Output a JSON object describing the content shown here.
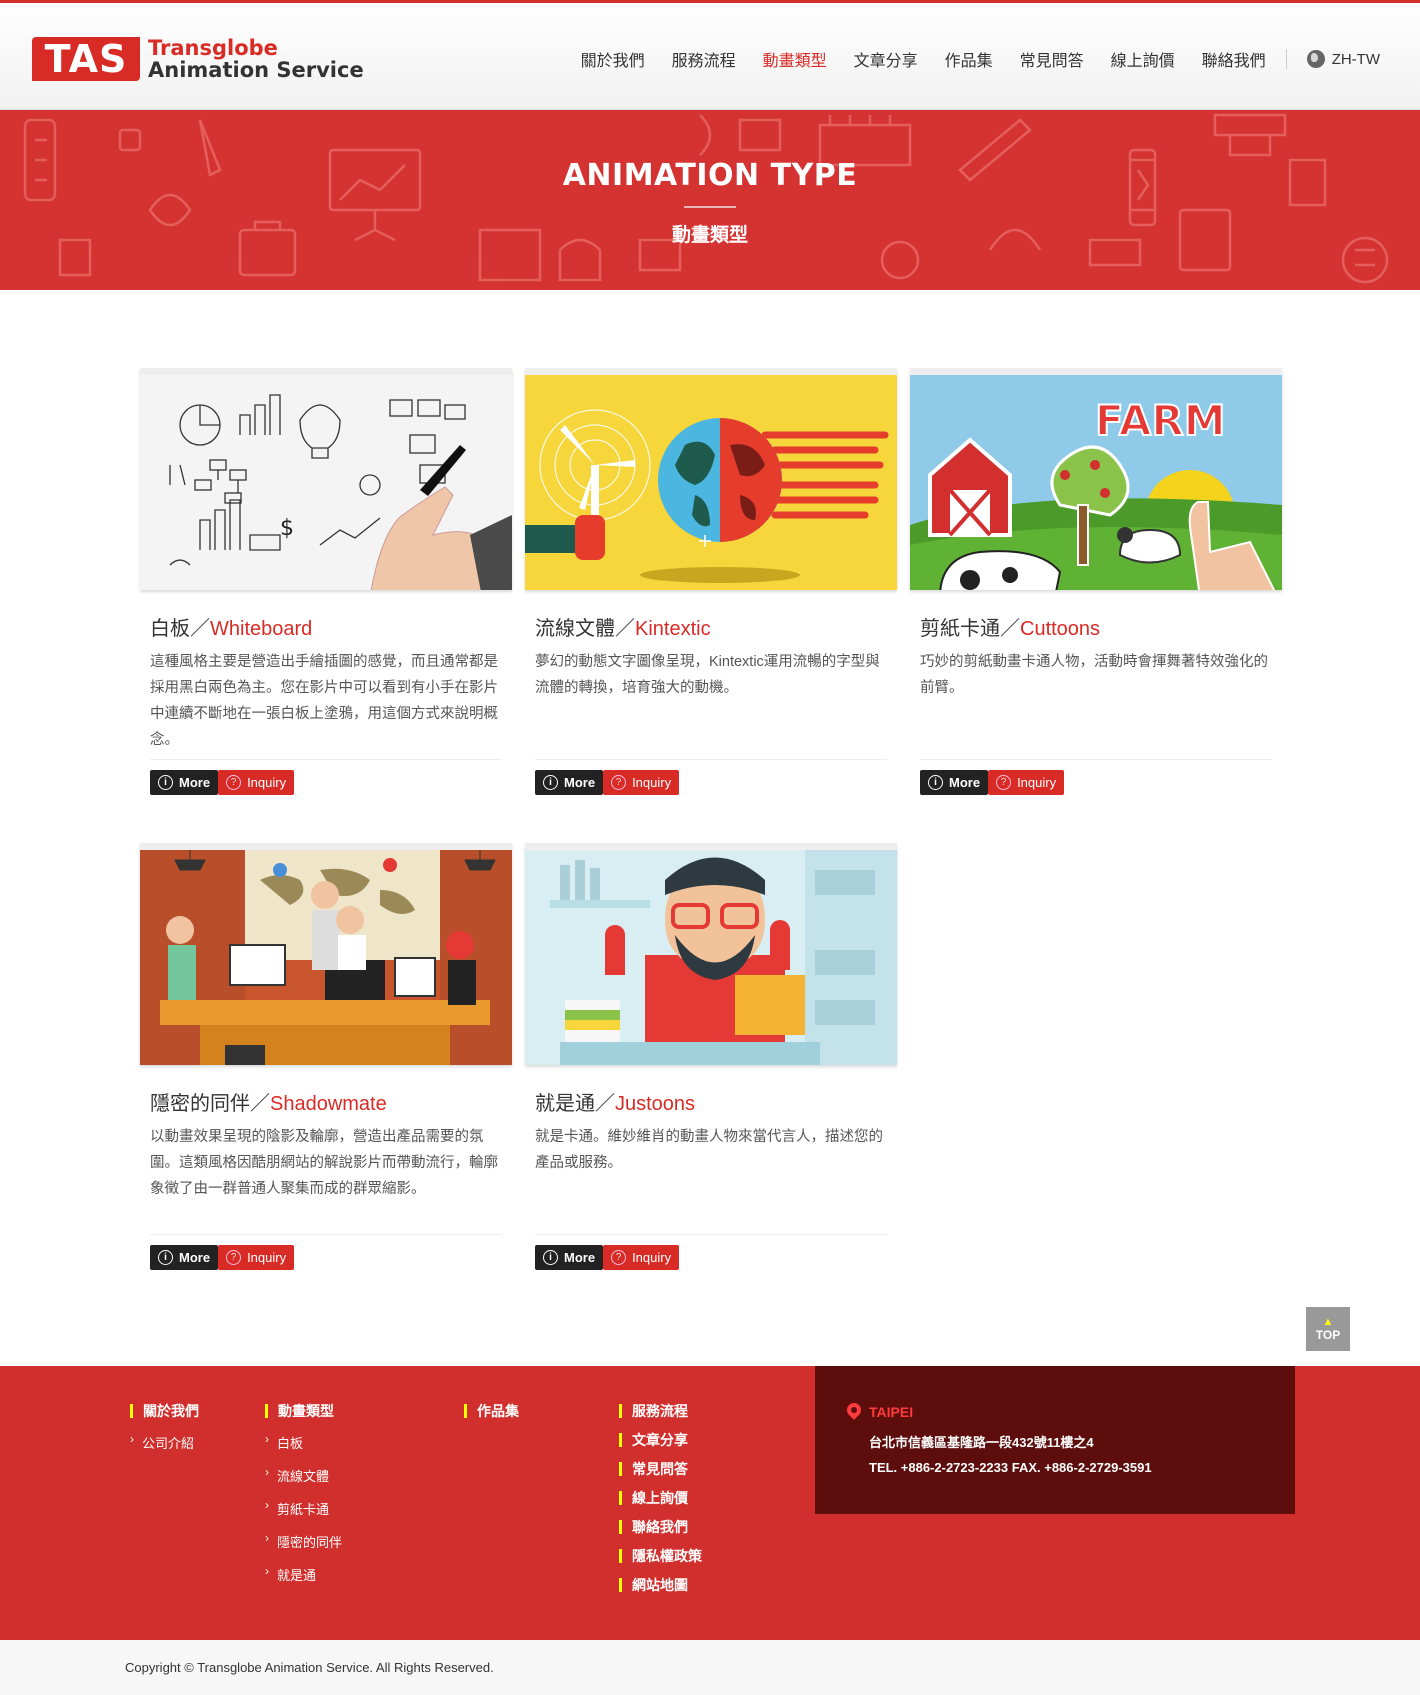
{
  "header": {
    "logo_mark": "TAS",
    "logo_line1": "Transglobe",
    "logo_line2": "Animation Service",
    "nav": [
      {
        "label": "關於我們"
      },
      {
        "label": "服務流程"
      },
      {
        "label": "動畫類型",
        "active": true
      },
      {
        "label": "文章分享"
      },
      {
        "label": "作品集"
      },
      {
        "label": "常見問答"
      },
      {
        "label": "線上詢價"
      },
      {
        "label": "聯絡我們"
      }
    ],
    "lang": "ZH-TW"
  },
  "banner": {
    "title": "ANIMATION TYPE",
    "subtitle": "動畫類型"
  },
  "cards": [
    {
      "title_zh": "白板／",
      "title_en": "Whiteboard",
      "desc": "這種風格主要是營造出手繪插圖的感覺，而且通常都是採用黑白兩色為主。您在影片中可以看到有小手在影片中連續不斷地在一張白板上塗鴉，用這個方式來說明概念。",
      "image_icon": "whiteboard-illustration",
      "more": "More",
      "inquiry": "Inquiry"
    },
    {
      "title_zh": "流線文體／",
      "title_en": "Kintextic",
      "desc": "夢幻的動態文字圖像呈現，Kintextic運用流暢的字型與流體的轉換，培育強大的動機。",
      "image_icon": "globe-windmill-illustration",
      "more": "More",
      "inquiry": "Inquiry"
    },
    {
      "title_zh": "剪紙卡通／",
      "title_en": "Cuttoons",
      "desc": "巧妙的剪紙動畫卡通人物，活動時會揮舞著特效強化的前臂。",
      "image_icon": "farm-illustration",
      "image_text": "FARM",
      "more": "More",
      "inquiry": "Inquiry"
    },
    {
      "title_zh": "隱密的同伴／",
      "title_en": "Shadowmate",
      "desc": "以動畫效果呈現的陰影及輪廓，營造出產品需要的氛圍。這類風格因酷朋網站的解說影片而帶動流行，輪廓象徵了由一群普通人聚集而成的群眾縮影。",
      "image_icon": "office-team-illustration",
      "more": "More",
      "inquiry": "Inquiry"
    },
    {
      "title_zh": "就是通／",
      "title_en": "Justoons",
      "desc": "就是卡通。維妙維肖的動畫人物來當代言人，描述您的產品或服務。",
      "image_icon": "bearded-man-illustration",
      "more": "More",
      "inquiry": "Inquiry"
    }
  ],
  "top_button": "TOP",
  "footer": {
    "col1": {
      "head": "關於我們",
      "items": [
        "公司介紹"
      ]
    },
    "col2": {
      "head": "動畫類型",
      "items": [
        "白板",
        "流線文體",
        "剪紙卡通",
        "隱密的同伴",
        "就是通"
      ]
    },
    "col3": {
      "head": "作品集",
      "items": []
    },
    "col4": {
      "heads": [
        "服務流程",
        "文章分享",
        "常見問答",
        "線上詢價",
        "聯絡我們",
        "隱私權政策",
        "網站地圖"
      ]
    },
    "address": {
      "city": "TAIPEI",
      "line1": "台北市信義區基隆路一段432號11樓之4",
      "line2": "TEL. +886-2-2723-2233 FAX. +886-2-2729-3591"
    }
  },
  "copyright": "Copyright © Transglobe Animation Service.   All Rights Reserved.",
  "colors": {
    "brand_red": "#d92b26",
    "banner_red": "#d53331",
    "address_bg": "#5e0d0d",
    "highlight": "#fff000"
  }
}
